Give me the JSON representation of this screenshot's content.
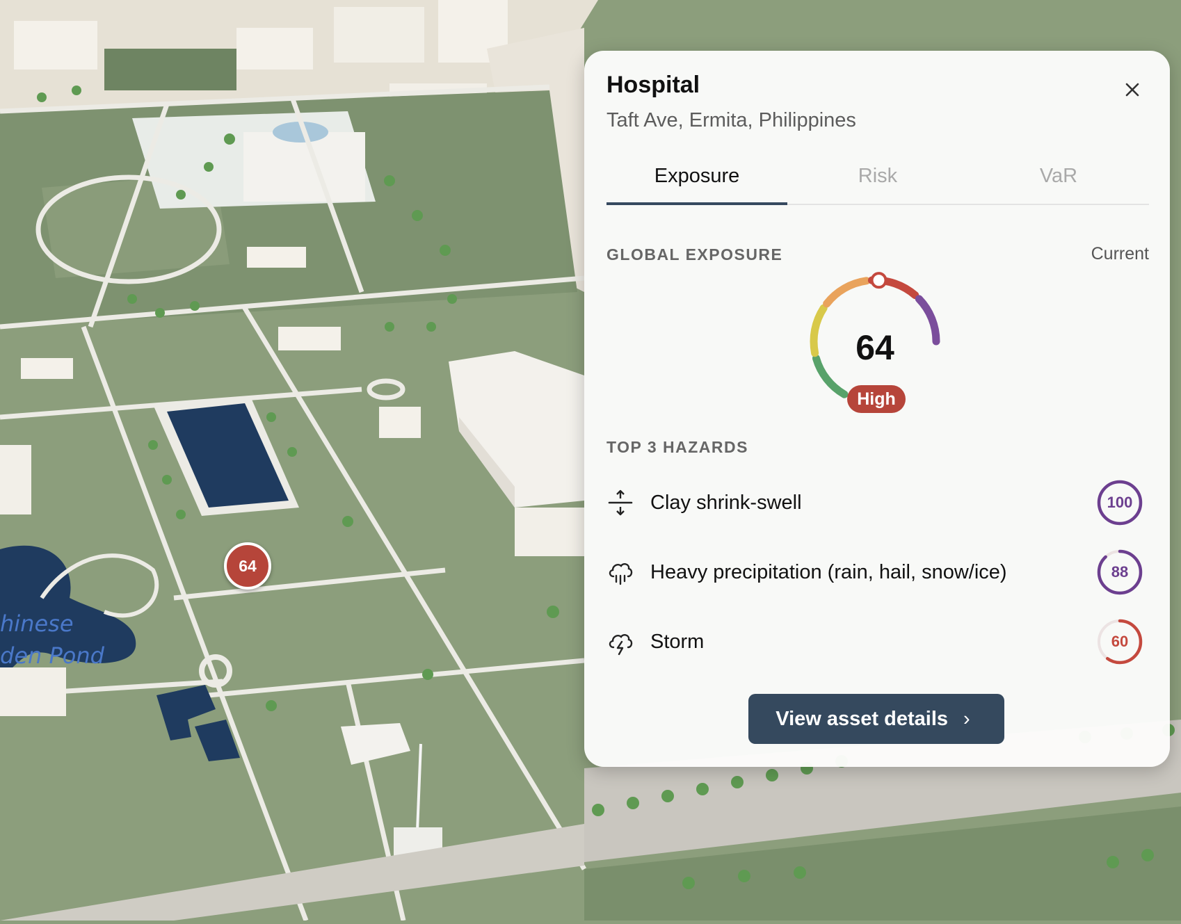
{
  "map": {
    "pond_label_line1": "hinese",
    "pond_label_line2": "den Pond",
    "marker_score": "64",
    "colors": {
      "grass": "#8c9e7c",
      "path": "#f1efe9",
      "water": "#1f3b5f",
      "building": "#efeae0"
    }
  },
  "panel": {
    "title": "Hospital",
    "address": "Taft Ave, Ermita, Philippines",
    "close_icon": "close-icon",
    "tabs": [
      {
        "label": "Exposure",
        "active": true
      },
      {
        "label": "Risk",
        "active": false
      },
      {
        "label": "VaR",
        "active": false
      }
    ],
    "global_exposure": {
      "label": "GLOBAL EXPOSURE",
      "period": "Current",
      "score": "64",
      "level": "High",
      "max": 100,
      "colors": [
        "#58a26a",
        "#d8c94a",
        "#e9a35c",
        "#c4493e",
        "#7b4e9c"
      ]
    },
    "hazards_label": "TOP 3 HAZARDS",
    "hazards": [
      {
        "name": "Clay shrink-swell",
        "score": "100",
        "value": 100,
        "color": "#6c3f8f",
        "icon": "clay-shrink-swell-icon"
      },
      {
        "name": "Heavy precipitation (rain, hail, snow/ice)",
        "score": "88",
        "value": 88,
        "color": "#6c3f8f",
        "icon": "heavy-rain-icon"
      },
      {
        "name": "Storm",
        "score": "60",
        "value": 60,
        "color": "#c4493e",
        "icon": "storm-icon"
      }
    ],
    "cta_label": "View asset details"
  }
}
